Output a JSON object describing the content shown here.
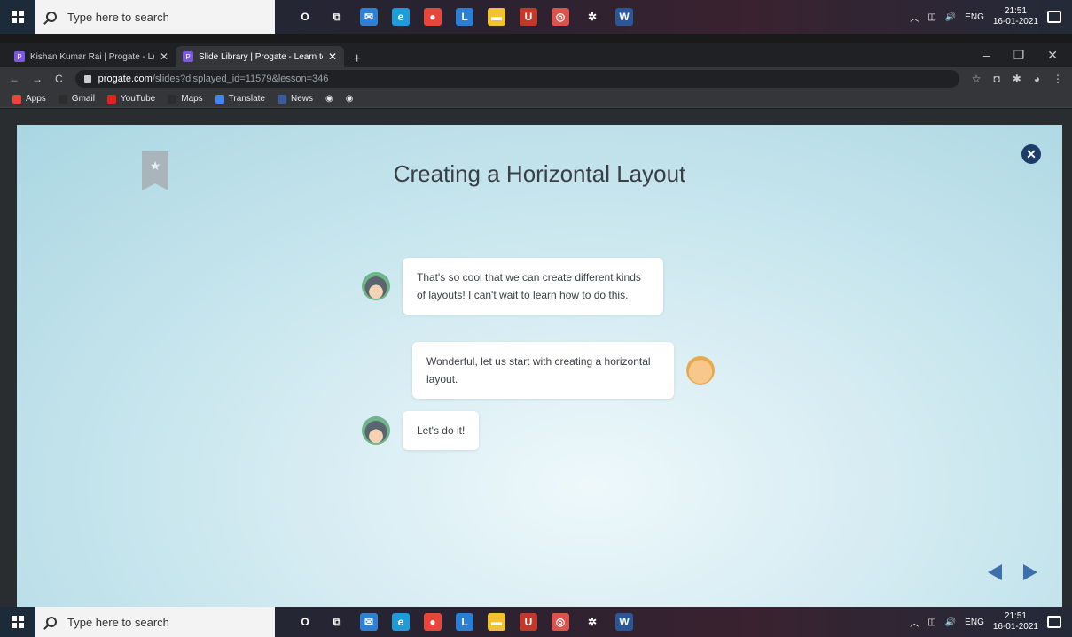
{
  "taskbar": {
    "search_placeholder": "Type here to search",
    "lang": "ENG",
    "time": "21:51",
    "date": "16-01-2021",
    "apps": [
      {
        "name": "cortana-icon",
        "glyph": "O",
        "color": "transparent"
      },
      {
        "name": "task-view-icon",
        "glyph": "⧉",
        "color": "transparent"
      },
      {
        "name": "mail-icon",
        "glyph": "✉",
        "color": "#2f7fd3"
      },
      {
        "name": "edge-icon",
        "glyph": "e",
        "color": "#1f9bd8"
      },
      {
        "name": "chrome-icon",
        "glyph": "●",
        "color": "#e8453c"
      },
      {
        "name": "launcher-icon",
        "glyph": "L",
        "color": "#2a7fd4"
      },
      {
        "name": "file-explorer-icon",
        "glyph": "▬",
        "color": "#f1c232"
      },
      {
        "name": "mcafee-icon",
        "glyph": "U",
        "color": "#c0392b"
      },
      {
        "name": "media-icon",
        "glyph": "◎",
        "color": "#d9534f"
      },
      {
        "name": "settings-icon",
        "glyph": "✲",
        "color": "transparent"
      },
      {
        "name": "word-icon",
        "glyph": "W",
        "color": "#2b579a"
      }
    ]
  },
  "browser": {
    "tabs": [
      {
        "title": "Kishan Kumar Rai | Progate - Lea",
        "active": false
      },
      {
        "title": "Slide Library | Progate - Learn to",
        "active": true
      }
    ],
    "url_host": "progate.com",
    "url_path": "/slides?displayed_id=11579&lesson=346",
    "bookmarks": [
      {
        "label": "Apps",
        "color": "#e8453c"
      },
      {
        "label": "Gmail",
        "color": "#2d2d2d"
      },
      {
        "label": "YouTube",
        "color": "#e62117"
      },
      {
        "label": "Maps",
        "color": "#2d2d2d"
      },
      {
        "label": "Translate",
        "color": "#4285f4"
      },
      {
        "label": "News",
        "color": "#3c5a9a"
      }
    ]
  },
  "slide": {
    "title": "Creating a Horizontal Layout",
    "messages": [
      {
        "speaker": "cat",
        "text": "That's so cool that we can create different kinds of layouts! I can't wait to learn how to do this."
      },
      {
        "speaker": "ninja",
        "text": "Wonderful, let us start with creating a horizontal layout."
      },
      {
        "speaker": "cat",
        "text": "Let's do it!"
      }
    ]
  },
  "colors": {
    "accent": "#3d6fa8",
    "close": "#1d3d68"
  }
}
